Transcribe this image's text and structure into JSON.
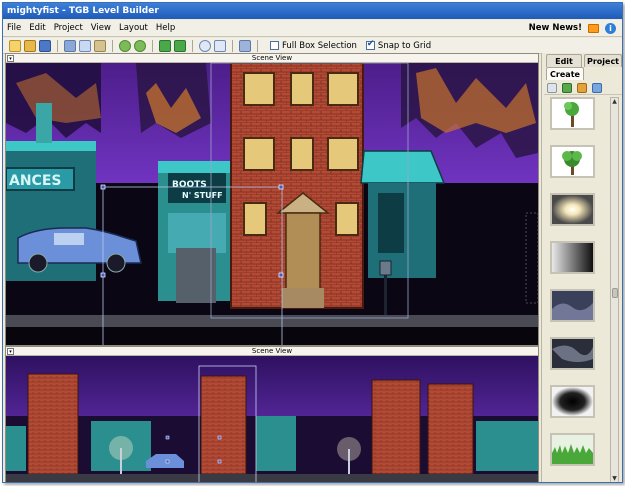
{
  "window": {
    "title": "mightyfist - TGB Level Builder"
  },
  "menu": {
    "items": [
      "File",
      "Edit",
      "Project",
      "View",
      "Layout",
      "Help"
    ],
    "news_label": "New News!"
  },
  "toolbar": {
    "buttons": [
      "new-icon",
      "open-icon",
      "save-icon",
      "cut-icon",
      "copy-icon",
      "paste-icon",
      "undo-icon",
      "redo-icon",
      "add-folder-icon",
      "folder-icon",
      "play-icon",
      "select-icon",
      "camera-icon"
    ],
    "full_box_selection": {
      "label": "Full Box Selection",
      "checked": false
    },
    "snap_to_grid": {
      "label": "Snap to Grid",
      "checked": true
    }
  },
  "scene_views": [
    {
      "label": "Scene View"
    },
    {
      "label": "Scene View"
    }
  ],
  "sidebar": {
    "tabs": [
      "Edit",
      "Project",
      "Create"
    ],
    "active_tab": "Create",
    "tools": [
      "page-icon",
      "image-icon",
      "grid-icon",
      "script-icon"
    ],
    "thumbnails": [
      "tree-thumbnail",
      "bush-thumbnail",
      "glow-thumbnail",
      "gradient-thumbnail",
      "fog-thumbnail",
      "smoke-thumbnail",
      "dark-circle-thumbnail",
      "grass-thumbnail"
    ]
  },
  "scene_text": {
    "shop_sign": "ANCES",
    "store_sign_line1": "BOOTS",
    "store_sign_line2": "N' STUFF"
  },
  "colors": {
    "title_bar": "#2a68c8",
    "sky_purple": "#6a2fb0",
    "brick": "#b24a35",
    "car_blue": "#6b8fd8",
    "teal_shop": "#3ec7c7"
  }
}
